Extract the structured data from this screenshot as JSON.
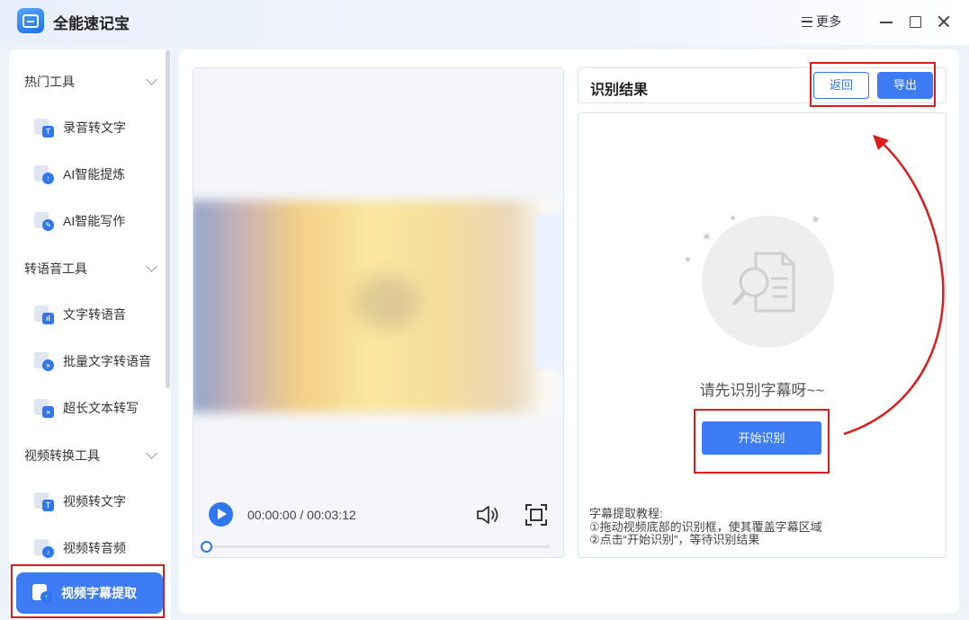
{
  "app": {
    "title": "全能速记宝"
  },
  "window": {
    "more_label": "更多"
  },
  "sidebar": {
    "groups": [
      {
        "label": "热门工具"
      },
      {
        "label": "转语音工具"
      },
      {
        "label": "视频转换工具"
      }
    ],
    "items": [
      {
        "label": "录音转文字",
        "icon": "record-to-text-icon",
        "badge": "T"
      },
      {
        "label": "AI智能提炼",
        "icon": "ai-extract-icon",
        "badge": "↑"
      },
      {
        "label": "AI智能写作",
        "icon": "ai-write-icon",
        "badge": "✎"
      },
      {
        "label": "文字转语音",
        "icon": "text-to-speech-icon",
        "badge": "ıl"
      },
      {
        "label": "批量文字转语音",
        "icon": "batch-tts-icon",
        "badge": "»"
      },
      {
        "label": "超长文本转写",
        "icon": "long-text-icon",
        "badge": "»"
      },
      {
        "label": "视频转文字",
        "icon": "video-to-text-icon",
        "badge": "T"
      },
      {
        "label": "视频转音频",
        "icon": "video-to-audio-icon",
        "badge": "♪"
      },
      {
        "label": "视频字幕提取",
        "icon": "subtitle-extract-icon",
        "badge": "↑",
        "active": true
      }
    ]
  },
  "player": {
    "time": "00:00:00 / 00:03:12",
    "progress": 0
  },
  "result": {
    "title": "识别结果",
    "back_label": "返回",
    "export_label": "导出",
    "empty_text": "请先识别字幕呀~~",
    "start_label": "开始识别",
    "tutorial": [
      "字幕提取教程:",
      "①拖动视频底部的识别框，使其覆盖字幕区域",
      "②点击“开始识别”，等待识别结果"
    ]
  },
  "colors": {
    "accent": "#3d7cf5",
    "highlight": "#e01b1b"
  }
}
